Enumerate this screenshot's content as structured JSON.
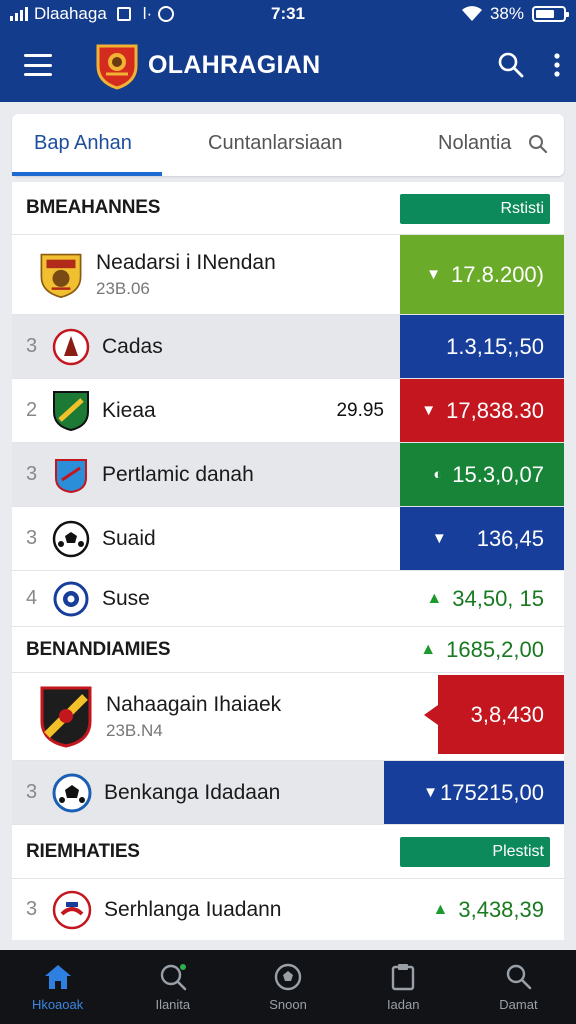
{
  "status_bar": {
    "carrier": "Dlaahaga",
    "extra_a": "l·",
    "time": "7:31",
    "battery": "38%"
  },
  "app_bar": {
    "title": "OLAHRAGIAN"
  },
  "tabs": [
    {
      "label": "Bap Anhan",
      "active": true
    },
    {
      "label": "Cuntanlarsiaan",
      "active": false
    },
    {
      "label": "Nolantia",
      "active": false
    }
  ],
  "sections": [
    {
      "title": "BMEAHANNES",
      "tag": "Rstisti",
      "rows": [
        {
          "rank": "",
          "name": "Neadarsi i INendan",
          "sub": "23B.06",
          "mid": "",
          "value": "17.8.200)",
          "arrow": "▼",
          "bg": "#6aab2a",
          "row": "white"
        },
        {
          "rank": "3",
          "name": "Cadas",
          "sub": "",
          "mid": "",
          "value": "1.3,15;,50",
          "arrow": "",
          "bg": "#163e9a",
          "row": "grey"
        },
        {
          "rank": "2",
          "name": "Kieaa",
          "sub": "",
          "mid": "29.95",
          "value": "17,838.30",
          "arrow": "▼",
          "bg": "#c3161e",
          "row": "white"
        },
        {
          "rank": "3",
          "name": "Pertlamic danah",
          "sub": "",
          "mid": "",
          "value": "15.3,0,07",
          "arrow": "◐",
          "bg": "#178437",
          "row": "grey"
        },
        {
          "rank": "3",
          "name": "Suaid",
          "sub": "",
          "mid": "",
          "value": "136,45",
          "arrow": "▼",
          "bg": "#163e9a",
          "row": "white"
        },
        {
          "rank": "4",
          "name": "Suse",
          "sub": "",
          "mid": "",
          "value": "34,50, 15",
          "arrow": "▲",
          "bg": "",
          "row": "white"
        }
      ]
    },
    {
      "title": "BENANDIAMIES",
      "tag": "",
      "header_value": "1685,2,00",
      "rows": [
        {
          "rank": "",
          "name": "Nahaagain Ihaiaek",
          "sub": "23B.N4",
          "mid": "",
          "value": "3,8,430",
          "arrow": "",
          "bg": "#c3161e",
          "row": "white"
        },
        {
          "rank": "3",
          "name": "Benkanga Idadaan",
          "sub": "",
          "mid": "",
          "value": "175215,00",
          "arrow": "▼",
          "bg": "#163e9a",
          "row": "grey"
        }
      ]
    },
    {
      "title": "RIEMHATIES",
      "tag": "Plestist",
      "rows": [
        {
          "rank": "3",
          "name": "Serhlanga Iuadann",
          "sub": "",
          "mid": "",
          "value": "3,438,39",
          "arrow": "▲",
          "bg": "",
          "row": "white"
        }
      ]
    }
  ],
  "bottom_nav": [
    {
      "label": "Hkoaoak",
      "icon": "home-icon",
      "active": true
    },
    {
      "label": "Ilanita",
      "icon": "search-icon",
      "active": false
    },
    {
      "label": "Snoon",
      "icon": "ball-icon",
      "active": false
    },
    {
      "label": "Iadan",
      "icon": "clipboard-icon",
      "active": false
    },
    {
      "label": "Damat",
      "icon": "profile-icon",
      "active": false
    }
  ]
}
